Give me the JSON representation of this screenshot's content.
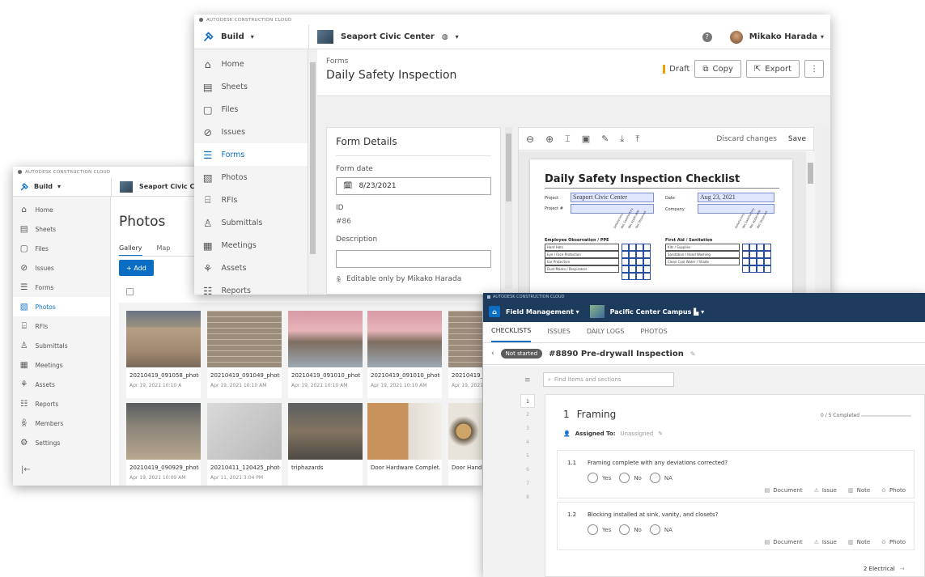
{
  "brand": "AUTODESK CONSTRUCTION CLOUD",
  "photos_window": {
    "module": "Build",
    "project": "Seaport Civic Cente",
    "nav": [
      "Home",
      "Sheets",
      "Files",
      "Issues",
      "Forms",
      "Photos",
      "RFIs",
      "Submittals",
      "Meetings",
      "Assets",
      "Reports",
      "Members",
      "Settings"
    ],
    "active_nav": "Photos",
    "title": "Photos",
    "tabs": [
      "Gallery",
      "Map"
    ],
    "add_label": "+ Add",
    "photos": [
      {
        "name": "20210419_091058_photo",
        "date": "Apr 19, 2021 10:10 A",
        "img": "brick-window"
      },
      {
        "name": "20210419_091049_photo",
        "date": "Apr 19, 2021 10:10 AM",
        "img": "brick-wall"
      },
      {
        "name": "20210419_091010_phot...",
        "date": "Apr 19, 2021 10:10 AM",
        "img": "insulation"
      },
      {
        "name": "20210419_091010_photo",
        "date": "Apr 19, 2021 10:10 AM",
        "img": "insulation"
      },
      {
        "name": "20210419_0",
        "date": "Apr 19, 2021",
        "img": "brick-wall"
      },
      {
        "name": "20210419_090929_photo",
        "date": "Apr 19, 2021 10:09 AM",
        "img": "foundation"
      },
      {
        "name": "20210411_120425_photo",
        "date": "Apr 11, 2021 3:04 PM",
        "img": "white-wall"
      },
      {
        "name": "triphazards",
        "date": "",
        "img": "debris"
      },
      {
        "name": "Door Hardware Complet...",
        "date": "",
        "img": "door-handle"
      },
      {
        "name": "Door Handle",
        "date": "",
        "img": "door-knob"
      }
    ]
  },
  "forms_window": {
    "module": "Build",
    "project": "Seaport Civic Center",
    "help": "?",
    "user": "Mikako Harada",
    "nav": [
      "Home",
      "Sheets",
      "Files",
      "Issues",
      "Forms",
      "Photos",
      "RFIs",
      "Submittals",
      "Meetings",
      "Assets",
      "Reports"
    ],
    "active_nav": "Forms",
    "breadcrumb": "Forms",
    "title": "Daily Safety Inspection",
    "status": "Draft",
    "copy_label": "Copy",
    "export_label": "Export",
    "details": {
      "heading": "Form Details",
      "date_label": "Form date",
      "date_value": "8/23/2021",
      "id_label": "ID",
      "id_value": "#86",
      "desc_label": "Description",
      "desc_value": "",
      "editable": "Editable only by Mikako Harada"
    },
    "pdf_toolbar": {
      "discard": "Discard changes",
      "save": "Save"
    },
    "checklist": {
      "title": "Daily Safety Inspection Checklist",
      "project_label": "Project",
      "project_value": "Seaport Civic Center",
      "project_no_label": "Project #",
      "date_label": "Date",
      "date_value": "Aug 23, 2021",
      "company_label": "Company",
      "left_heading": "Employee Observation / PPE",
      "left_rows": [
        "Hard Hats",
        "Eye / Face Protection",
        "Ear Protection",
        "Dust Masks / Respirators"
      ],
      "right_heading": "First Aid / Sanitation",
      "right_rows": [
        "Kits / Supplies",
        "Sanitation / Hand Washing",
        "Clean Cool Water / Shade"
      ],
      "col_headers": [
        "Satisfactory",
        "Not Satisfactory",
        "Not Applicable",
        "Not Observed"
      ]
    }
  },
  "field_window": {
    "brand": "AUTODESK CONSTRUCTION CLOUD",
    "app": "Field Management",
    "project": "Pacific Center Campus",
    "tabs": [
      "CHECKLISTS",
      "ISSUES",
      "DAILY LOGS",
      "PHOTOS"
    ],
    "active_tab": "CHECKLISTS",
    "status": "Not started",
    "title": "#8890  Pre-drywall Inspection",
    "search_placeholder": "Find items and sections",
    "section_numbers": [
      "1",
      "2",
      "3",
      "4",
      "5",
      "6",
      "7",
      "8"
    ],
    "section_number": "1",
    "section_title": "Framing",
    "progress": "0 / 5 Completed",
    "progress_fraction": 0,
    "assigned_label": "Assigned To:",
    "assigned_value": "Unassigned",
    "items": [
      {
        "num": "1.1",
        "text": "Framing complete with any deviations corrected?"
      },
      {
        "num": "1.2",
        "text": "Blocking installed at sink, vanity, and closets?"
      }
    ],
    "options": [
      "Yes",
      "No",
      "NA"
    ],
    "actions": [
      "Document",
      "Issue",
      "Note",
      "Photo"
    ],
    "next_section": "2 Electrical"
  }
}
